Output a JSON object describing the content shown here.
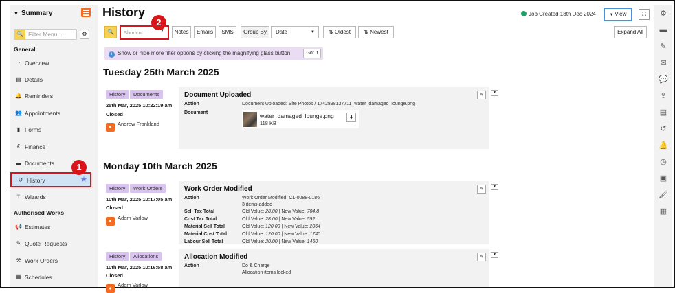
{
  "sidebar": {
    "header": "Summary",
    "search_placeholder": "Filter Menu...",
    "sections": [
      "General",
      "Authorised Works"
    ],
    "items": [
      {
        "label": "Overview",
        "icon": "speedometer-icon"
      },
      {
        "label": "Details",
        "icon": "clipboard-icon"
      },
      {
        "label": "Reminders",
        "icon": "bell-icon"
      },
      {
        "label": "Appointments",
        "icon": "users-icon"
      },
      {
        "label": "Forms",
        "icon": "file-icon"
      },
      {
        "label": "Finance",
        "icon": "pound-icon"
      },
      {
        "label": "Documents",
        "icon": "folder-icon"
      },
      {
        "label": "History",
        "icon": "history-icon"
      },
      {
        "label": "Wizards",
        "icon": "wand-icon"
      },
      {
        "label": "Estimates",
        "icon": "megaphone-icon"
      },
      {
        "label": "Quote Requests",
        "icon": "pencil-icon"
      },
      {
        "label": "Work Orders",
        "icon": "hammer-icon"
      },
      {
        "label": "Schedules",
        "icon": "calendar-icon"
      }
    ]
  },
  "page_title": "History",
  "job_created": "Job Created 18th Dec 2024",
  "view_label": "View",
  "toolbar": {
    "shortcut_placeholder": "Shortcut...",
    "notes": "Notes",
    "emails": "Emails",
    "sms": "SMS",
    "group_by": "Group By",
    "group_value": "Date",
    "oldest": "Oldest",
    "newest": "Newest",
    "expand_all": "Expand All"
  },
  "info_banner": "Show or hide more filter options by clicking the magnifying glass button",
  "got_it": "Got It",
  "annotations": [
    "1",
    "2"
  ],
  "days": [
    {
      "heading": "Tuesday 25th March 2025",
      "entries": [
        {
          "tags": [
            "History",
            "Documents"
          ],
          "datetime": "25th Mar, 2025 10:22:19 am",
          "status": "Closed",
          "user": "Andrew Frankland",
          "title": "Document Uploaded",
          "action_label": "Action",
          "action": "Document Uploaded: Site Photos / 1742898137711_water_damaged_lounge.png",
          "document_label": "Document",
          "file_name": "water_damaged_lounge.png",
          "file_size": "118 KB"
        }
      ]
    },
    {
      "heading": "Monday 10th March 2025",
      "entries": [
        {
          "tags": [
            "History",
            "Work Orders"
          ],
          "datetime": "10th Mar, 2025 10:17:05 am",
          "status": "Closed",
          "user": "Adam Varlow",
          "title": "Work Order Modified",
          "action_label": "Action",
          "action": "Work Order Modified: CL-0088-0186",
          "action2": "3 items added",
          "changes": [
            {
              "label": "Sell Tax Total",
              "old": "28.00",
              "new": "704.8"
            },
            {
              "label": "Cost Tax Total",
              "old": "28.00",
              "new": "592"
            },
            {
              "label": "Material Sell Total",
              "old": "120.00",
              "new": "2064"
            },
            {
              "label": "Material Cost Total",
              "old": "120.00",
              "new": "1740"
            },
            {
              "label": "Labour Sell Total",
              "old": "20.00",
              "new": "1460"
            }
          ],
          "old_prefix": "Old Value:",
          "new_prefix": "New Value:"
        },
        {
          "tags": [
            "History",
            "Allocations"
          ],
          "datetime": "10th Mar, 2025 10:16:58 am",
          "status": "Closed",
          "user": "Adam Varlow",
          "title": "Allocation Modified",
          "action_label": "Action",
          "action": "Do & Charge",
          "action2": "Allocation items locked"
        }
      ]
    }
  ],
  "colors": {
    "accent_orange": "#f26b22",
    "highlight_red": "#d9141b",
    "tag_purple": "#d9c3ef",
    "active_blue": "#cfe3f5"
  }
}
